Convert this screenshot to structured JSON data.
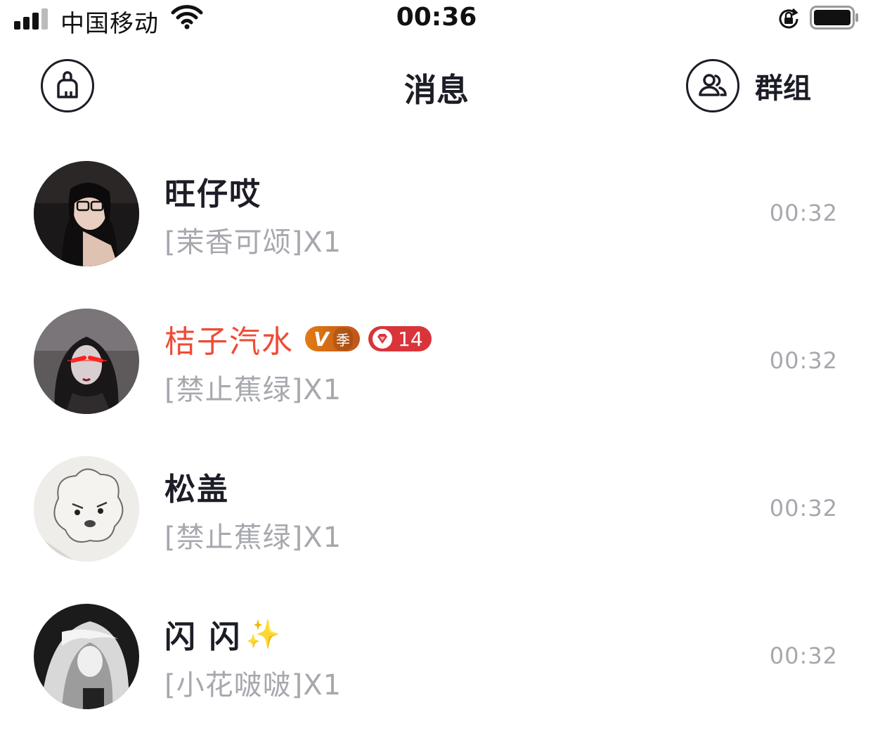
{
  "status_bar": {
    "carrier": "中国移动",
    "time": "00:36",
    "icons": [
      "signal-icon",
      "wifi-icon",
      "orientation-lock-icon",
      "battery-icon"
    ]
  },
  "header": {
    "title": "消息",
    "clear_icon": "broom-clean-icon",
    "group_label": "群组",
    "group_icon": "users-icon"
  },
  "messages": [
    {
      "name": "旺仔哎",
      "preview": "[茉香可颂]X1",
      "time": "00:32",
      "name_color": "#1c1d26"
    },
    {
      "name": "桔子汽水",
      "preview": "[禁止蕉绿]X1",
      "time": "00:32",
      "name_color": "#ee4b35",
      "badges": {
        "vip_letter": "V",
        "vip_season": "季",
        "gift_count": "14"
      }
    },
    {
      "name": "松盖",
      "preview": "[禁止蕉绿]X1",
      "time": "00:32",
      "name_color": "#1c1d26"
    },
    {
      "name": "闪 闪",
      "emoji": "✨",
      "preview": "[小花啵啵]X1",
      "time": "00:32",
      "name_color": "#1c1d26"
    }
  ],
  "colors": {
    "accent_red": "#ee4b35",
    "text_dark": "#1c1d26",
    "text_gray": "#a7a8ae"
  }
}
